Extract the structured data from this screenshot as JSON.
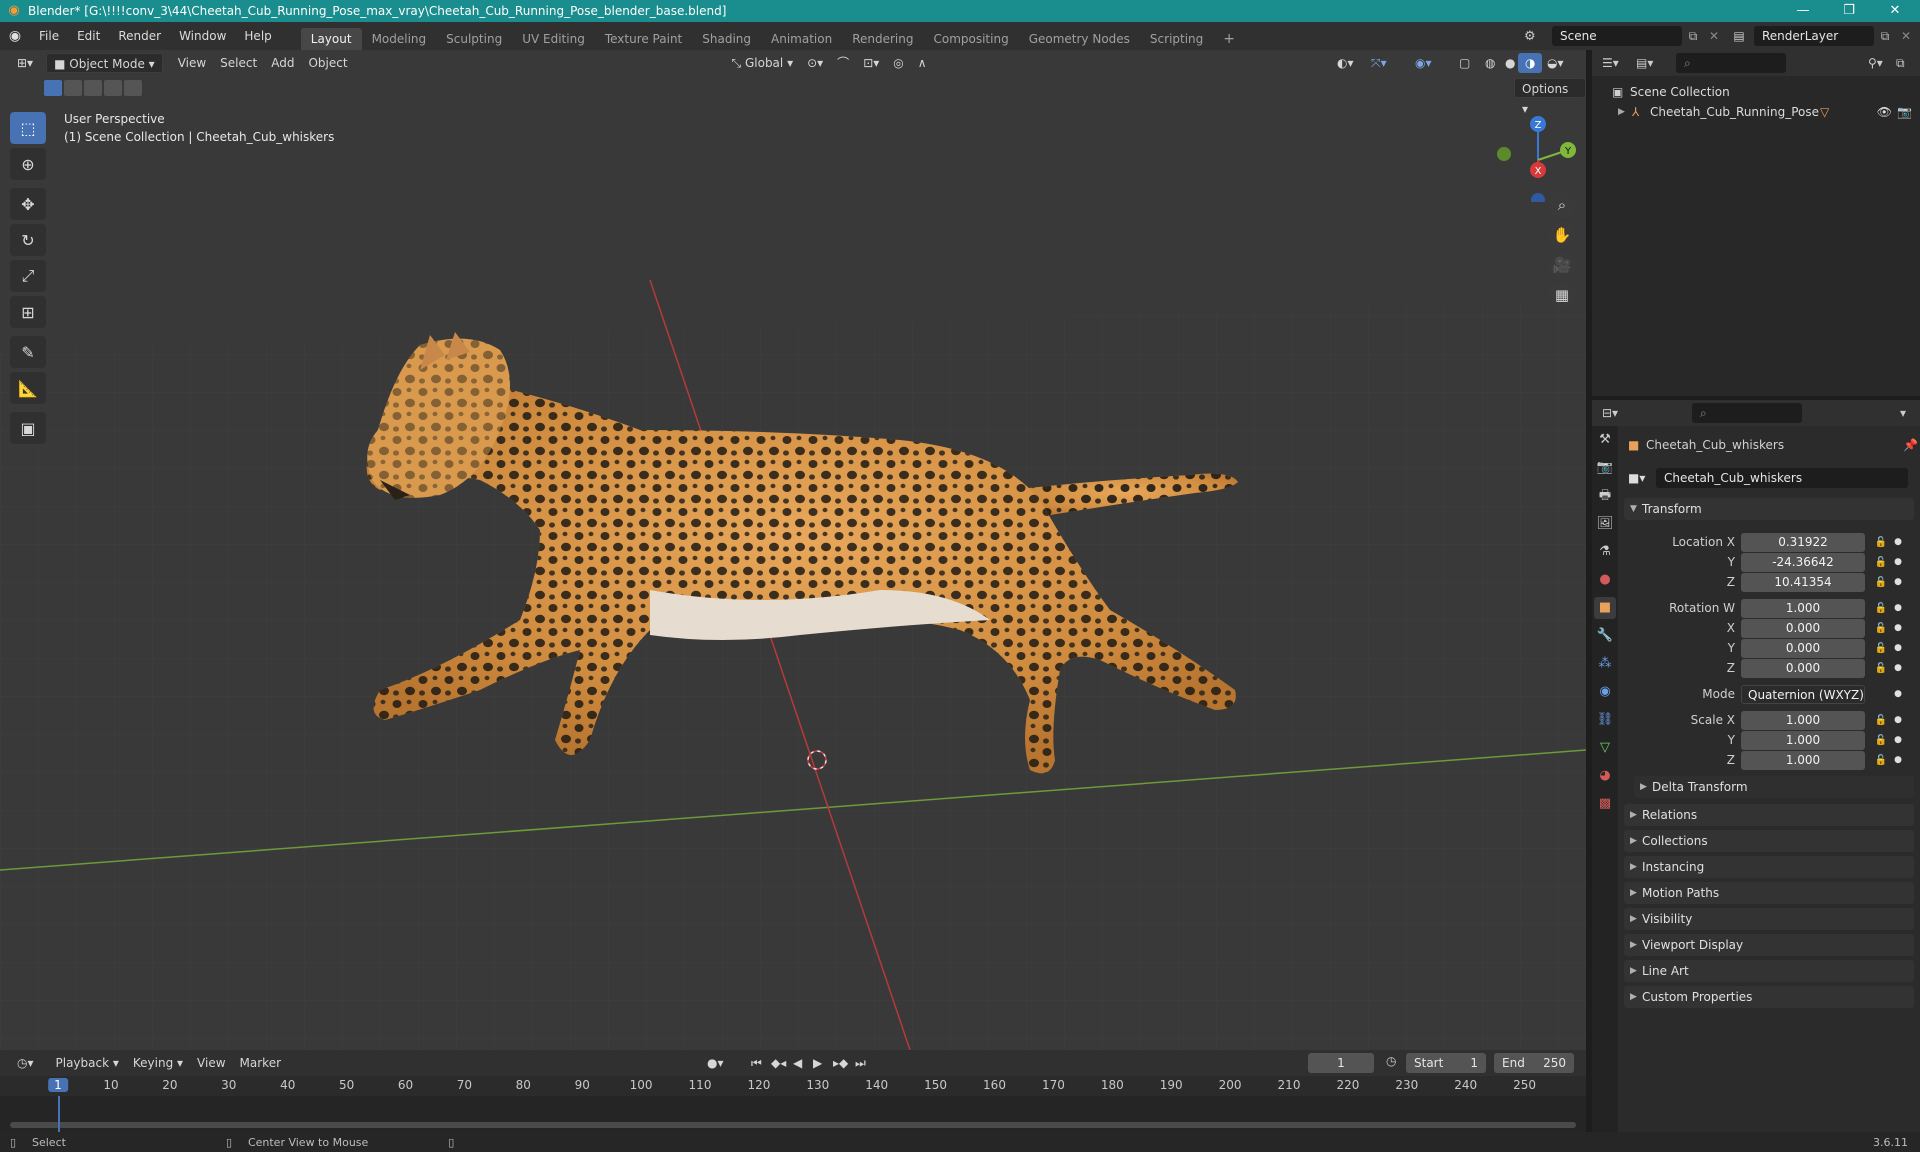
{
  "window": {
    "title": "Blender* [G:\\!!!!conv_3\\44\\Cheetah_Cub_Running_Pose_max_vray\\Cheetah_Cub_Running_Pose_blender_base.blend]"
  },
  "menu": [
    "File",
    "Edit",
    "Render",
    "Window",
    "Help"
  ],
  "workspaces": [
    {
      "label": "Layout",
      "active": true
    },
    {
      "label": "Modeling"
    },
    {
      "label": "Sculpting"
    },
    {
      "label": "UV Editing"
    },
    {
      "label": "Texture Paint"
    },
    {
      "label": "Shading"
    },
    {
      "label": "Animation"
    },
    {
      "label": "Rendering"
    },
    {
      "label": "Compositing"
    },
    {
      "label": "Geometry Nodes"
    },
    {
      "label": "Scripting"
    }
  ],
  "add_workspace": "+",
  "scene": {
    "label": "Scene",
    "render_layer": "RenderLayer"
  },
  "viewport": {
    "mode": "Object Mode",
    "menus": [
      "View",
      "Select",
      "Add",
      "Object"
    ],
    "orientation": "Global",
    "options": "Options",
    "info_line1": "User Perspective",
    "info_line2": "(1) Scene Collection | Cheetah_Cub_whiskers",
    "gizmo": {
      "x": "X",
      "y": "Y",
      "z": "Z"
    }
  },
  "outliner": {
    "root": "Scene Collection",
    "items": [
      {
        "label": "Cheetah_Cub_Running_Pose"
      }
    ]
  },
  "properties": {
    "object_name": "Cheetah_Cub_whiskers",
    "data_name": "Cheetah_Cub_whiskers",
    "transform_header": "Transform",
    "location": {
      "label_x": "Location X",
      "label_y": "Y",
      "label_z": "Z",
      "x": "0.31922",
      "y": "-24.36642",
      "z": "10.41354"
    },
    "rotation": {
      "label_w": "Rotation W",
      "label_x": "X",
      "label_y": "Y",
      "label_z": "Z",
      "w": "1.000",
      "x": "0.000",
      "y": "0.000",
      "z": "0.000"
    },
    "mode_label": "Mode",
    "mode_value": "Quaternion (WXYZ)",
    "scale": {
      "label_x": "Scale X",
      "label_y": "Y",
      "label_z": "Z",
      "x": "1.000",
      "y": "1.000",
      "z": "1.000"
    },
    "delta_transform": "Delta Transform",
    "panels": [
      "Relations",
      "Collections",
      "Instancing",
      "Motion Paths",
      "Visibility",
      "Viewport Display",
      "Line Art",
      "Custom Properties"
    ]
  },
  "timeline": {
    "menus": [
      "Playback",
      "Keying",
      "View",
      "Marker"
    ],
    "current_frame": "1",
    "start_label": "Start",
    "start": "1",
    "end_label": "End",
    "end": "250",
    "ticks": [
      "1",
      "10",
      "20",
      "30",
      "40",
      "50",
      "60",
      "70",
      "80",
      "90",
      "100",
      "110",
      "120",
      "130",
      "140",
      "150",
      "160",
      "170",
      "180",
      "190",
      "200",
      "210",
      "220",
      "230",
      "240",
      "250"
    ]
  },
  "status": {
    "select": "Select",
    "center": "Center View to Mouse",
    "version": "3.6.11"
  },
  "colors": {
    "accent": "#4772b3",
    "titlebar": "#1a8d8e",
    "x_axis": "#d63a3a",
    "y_axis": "#7fb83a",
    "z_axis": "#3a78d6"
  }
}
